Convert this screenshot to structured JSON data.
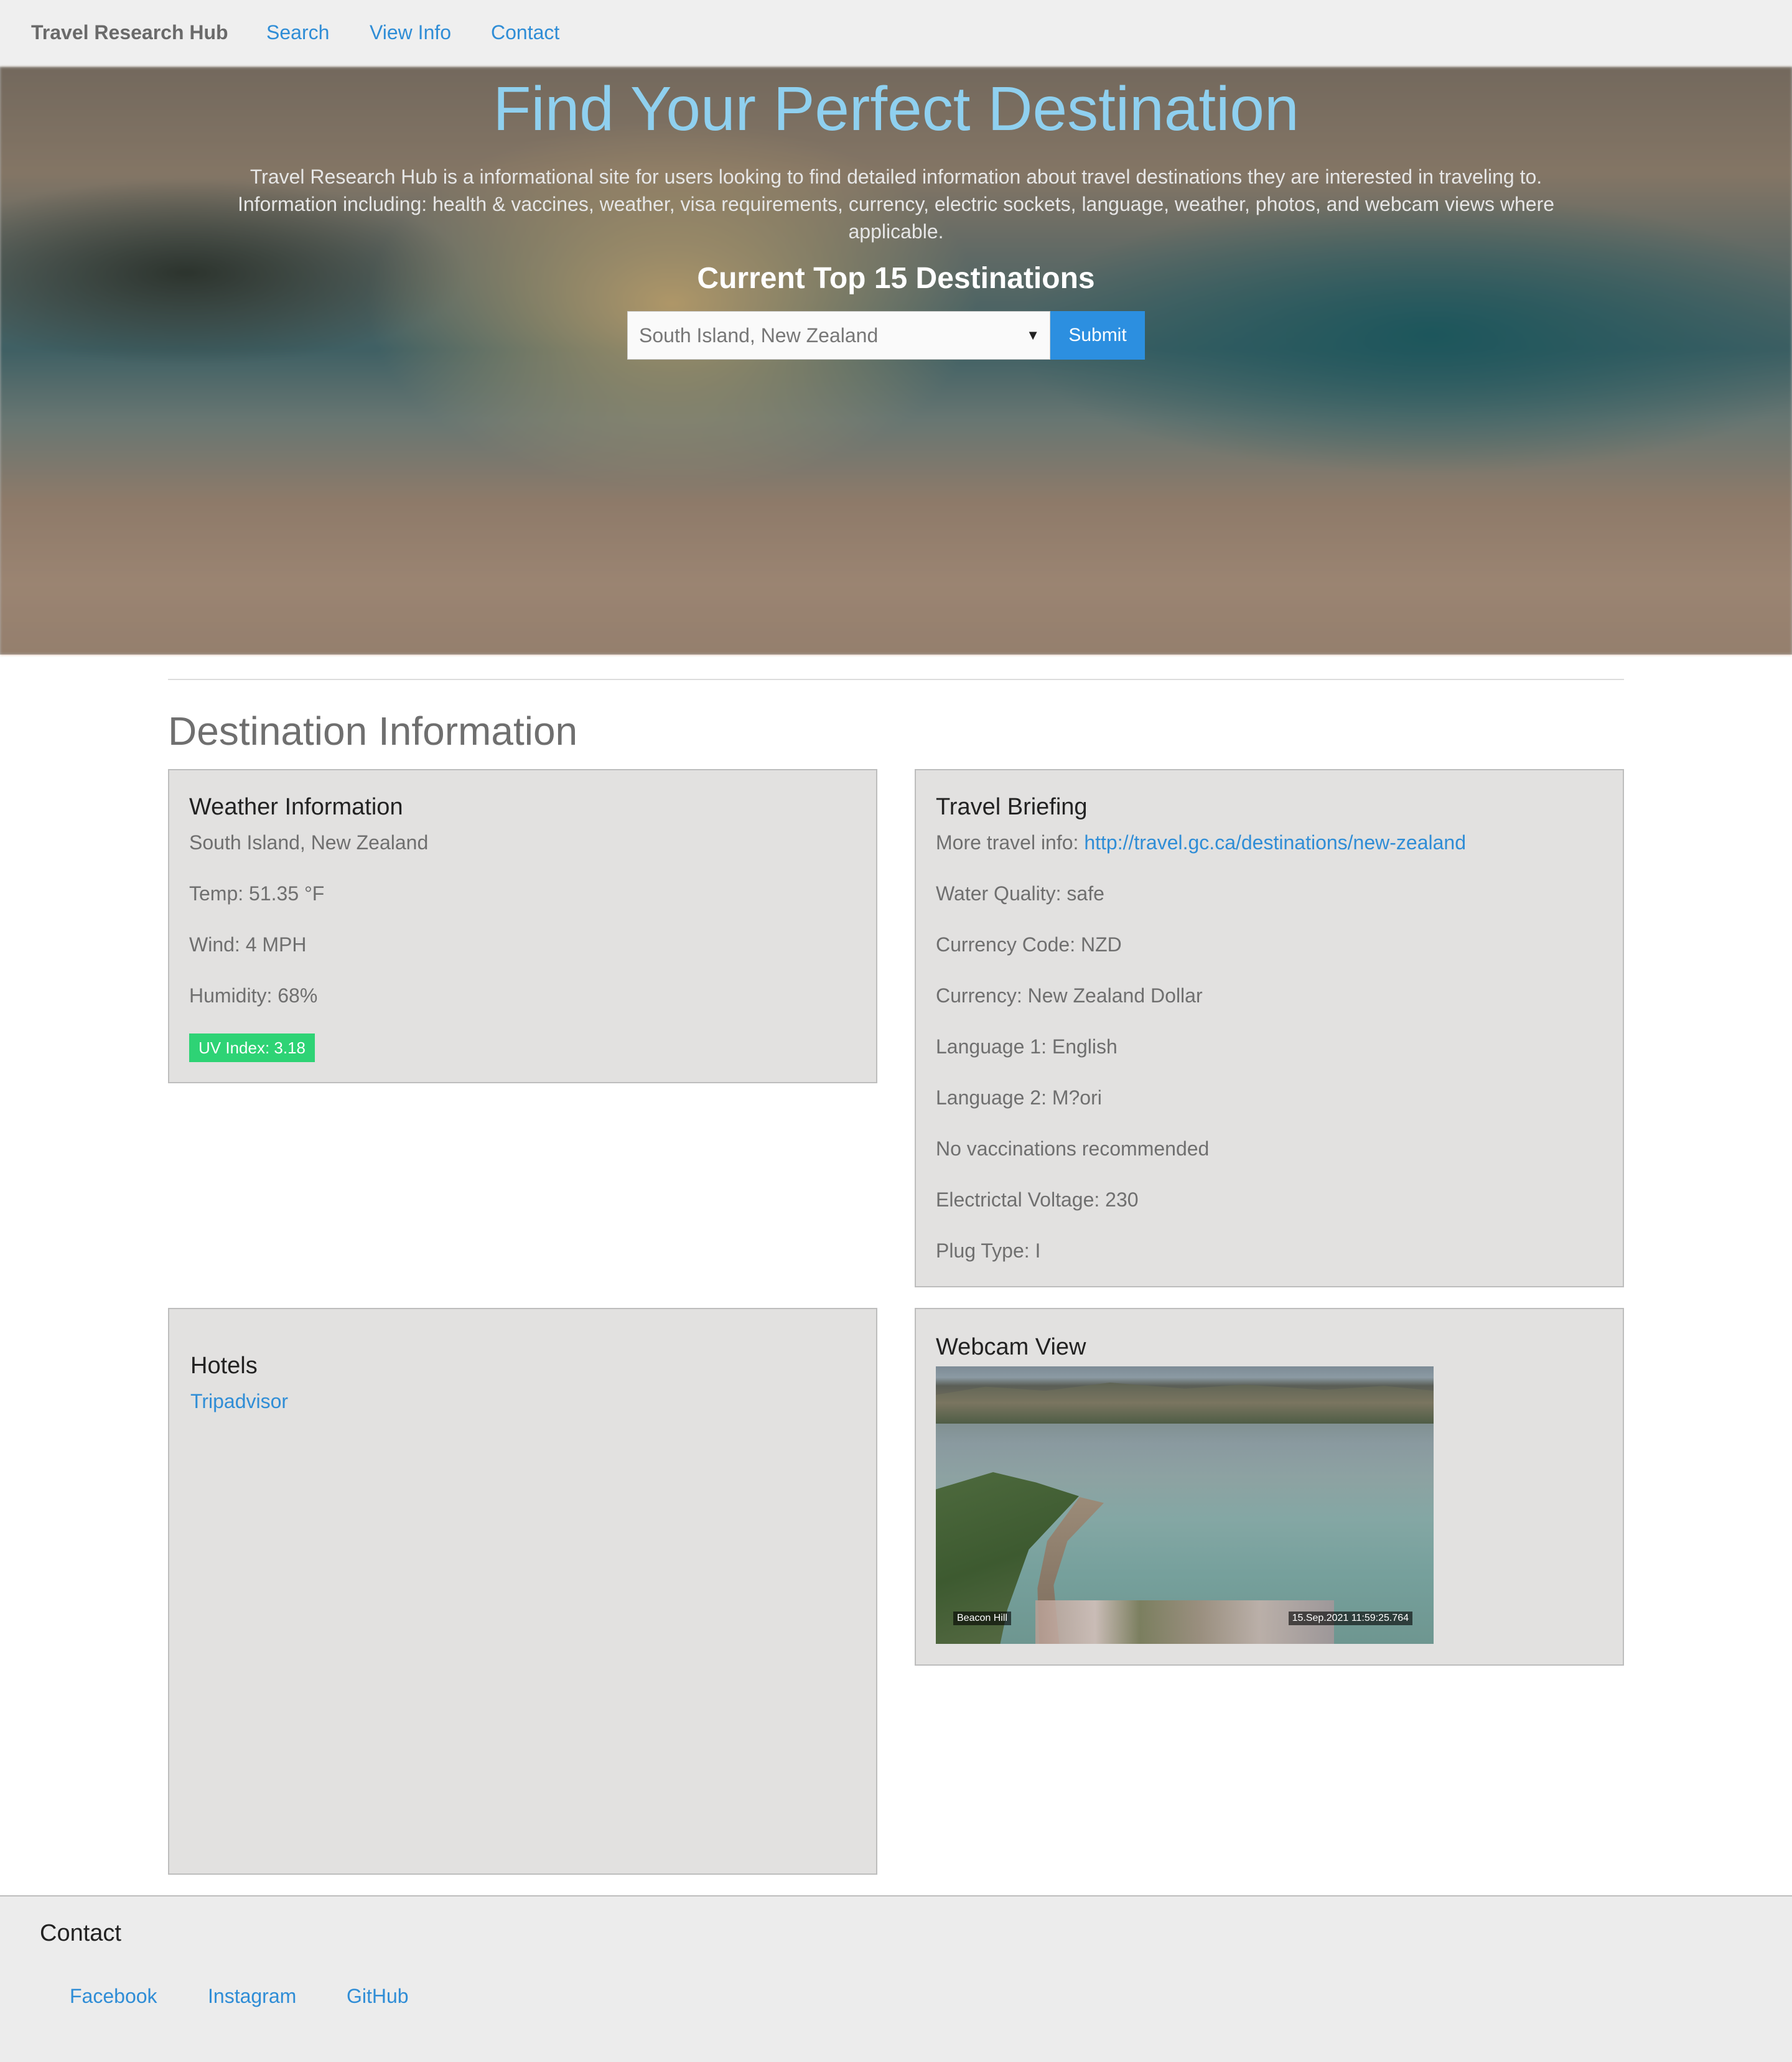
{
  "navbar": {
    "brand": "Travel Research Hub",
    "links": [
      "Search",
      "View Info",
      "Contact"
    ]
  },
  "hero": {
    "title": "Find Your Perfect Destination",
    "description": "Travel Research Hub is a informational site for users looking to find detailed information about travel destinations they are interested in traveling to. Information including: health & vaccines, weather, visa requirements, currency, electric sockets, language, weather, photos, and webcam views where applicable.",
    "subtitle": "Current Top 15 Destinations",
    "select_value": "South Island, New Zealand",
    "submit_label": "Submit"
  },
  "section_title": "Destination Information",
  "weather": {
    "title": "Weather Information",
    "location": "South Island, New Zealand",
    "temp": "Temp: 51.35 °F",
    "wind": "Wind: 4 MPH",
    "humidity": "Humidity: 68%",
    "uv": "UV Index: 3.18"
  },
  "briefing": {
    "title": "Travel Briefing",
    "more_info_label": "More travel info: ",
    "more_info_link": "http://travel.gc.ca/destinations/new-zealand",
    "lines": [
      "Water Quality: safe",
      "Currency Code: NZD",
      "Currency: New Zealand Dollar",
      "Language 1: English",
      "Language 2: M?ori",
      "No vaccinations recommended",
      "Electrictal Voltage: 230",
      "Plug Type: I"
    ]
  },
  "hotels": {
    "title": "Hotels",
    "link": "Tripadvisor"
  },
  "webcam": {
    "title": "Webcam View",
    "label_left": "Beacon Hill",
    "label_right": "15.Sep.2021 11:59:25.764"
  },
  "footer": {
    "title": "Contact",
    "links": [
      "Facebook",
      "Instagram",
      "GitHub"
    ]
  },
  "colors": {
    "accent": "#2f8dd6",
    "hero_title": "#8fd0ef",
    "uv_badge": "#2ed375",
    "panel_bg": "#e2e1e0"
  }
}
